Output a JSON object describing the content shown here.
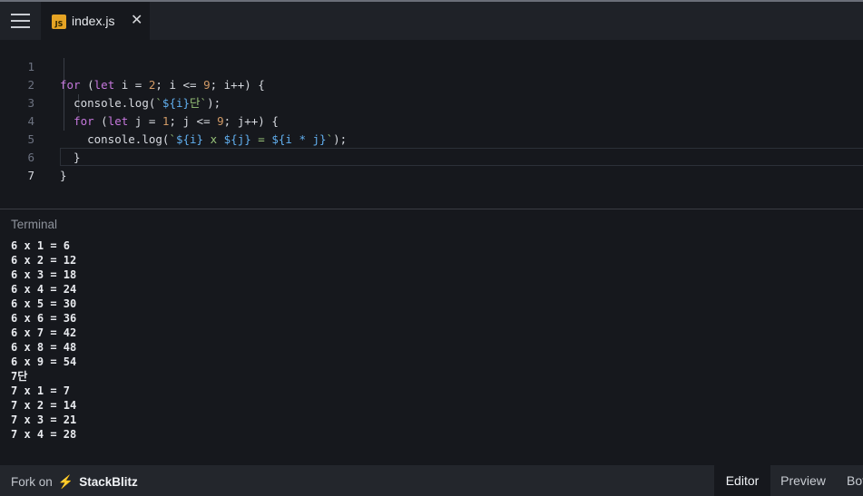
{
  "tabs": [
    {
      "icon": "js-file-icon",
      "icon_text": "JS",
      "label": "index.js"
    }
  ],
  "editor": {
    "line_numbers": [
      "1",
      "2",
      "3",
      "4",
      "5",
      "6",
      "7"
    ],
    "active_line": "7"
  },
  "terminal": {
    "title": "Terminal",
    "lines": [
      "6 x 1 = 6",
      "6 x 2 = 12",
      "6 x 3 = 18",
      "6 x 4 = 24",
      "6 x 5 = 30",
      "6 x 6 = 36",
      "6 x 7 = 42",
      "6 x 8 = 48",
      "6 x 9 = 54",
      "7단",
      "7 x 1 = 7",
      "7 x 2 = 14",
      "7 x 3 = 21",
      "7 x 4 = 28"
    ]
  },
  "footer": {
    "fork_label": "Fork on",
    "brand": "StackBlitz",
    "view_tabs": [
      "Editor",
      "Preview",
      "Both"
    ],
    "active_view": "Editor"
  },
  "colors": {
    "background": "#16181d",
    "tab_bar": "#1f2228",
    "footer": "#23262c",
    "keyword": "#c678dd",
    "number": "#d19a66",
    "string": "#98c379",
    "template_expr": "#61afef",
    "brand_bolt": "#1389fd",
    "js_badge": "#e5a324"
  }
}
